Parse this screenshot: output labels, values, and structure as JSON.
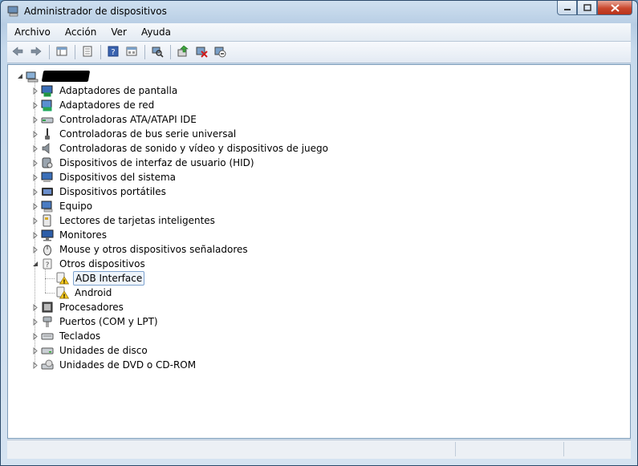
{
  "window": {
    "title": "Administrador de dispositivos"
  },
  "menu": [
    "Archivo",
    "Acción",
    "Ver",
    "Ayuda"
  ],
  "toolbar": [
    "back-icon",
    "forward-icon",
    "sep",
    "show-hide-tree-icon",
    "sep",
    "properties-icon",
    "sep",
    "help-icon",
    "view-icon",
    "sep",
    "scan-hardware-icon",
    "sep",
    "update-driver-icon",
    "uninstall-icon",
    "disable-icon"
  ],
  "tree": {
    "categories": [
      {
        "label": "Adaptadores de pantalla",
        "icon": "display-adapter-icon",
        "expanded": false
      },
      {
        "label": "Adaptadores de red",
        "icon": "network-adapter-icon",
        "expanded": false
      },
      {
        "label": "Controladoras ATA/ATAPI IDE",
        "icon": "ide-controller-icon",
        "expanded": false
      },
      {
        "label": "Controladoras de bus serie universal",
        "icon": "usb-icon",
        "expanded": false
      },
      {
        "label": "Controladoras de sonido y vídeo y dispositivos de juego",
        "icon": "speaker-icon",
        "expanded": false
      },
      {
        "label": "Dispositivos de interfaz de usuario (HID)",
        "icon": "hid-icon",
        "expanded": false
      },
      {
        "label": "Dispositivos del sistema",
        "icon": "system-device-icon",
        "expanded": false
      },
      {
        "label": "Dispositivos portátiles",
        "icon": "portable-device-icon",
        "expanded": false
      },
      {
        "label": "Equipo",
        "icon": "computer-icon",
        "expanded": false
      },
      {
        "label": "Lectores de tarjetas inteligentes",
        "icon": "smart-card-reader-icon",
        "expanded": false
      },
      {
        "label": "Monitores",
        "icon": "monitor-icon",
        "expanded": false
      },
      {
        "label": "Mouse y otros dispositivos señaladores",
        "icon": "mouse-icon",
        "expanded": false
      },
      {
        "label": "Otros dispositivos",
        "icon": "unknown-device-icon",
        "expanded": true,
        "children": [
          {
            "label": "ADB Interface",
            "icon": "warning-device-icon",
            "selected": true
          },
          {
            "label": "Android",
            "icon": "warning-device-icon",
            "selected": false
          }
        ]
      },
      {
        "label": "Procesadores",
        "icon": "processor-icon",
        "expanded": false
      },
      {
        "label": "Puertos (COM y LPT)",
        "icon": "port-icon",
        "expanded": false
      },
      {
        "label": "Teclados",
        "icon": "keyboard-icon",
        "expanded": false
      },
      {
        "label": "Unidades de disco",
        "icon": "disk-drive-icon",
        "expanded": false
      },
      {
        "label": "Unidades de DVD o CD-ROM",
        "icon": "dvd-drive-icon",
        "expanded": false
      }
    ]
  }
}
